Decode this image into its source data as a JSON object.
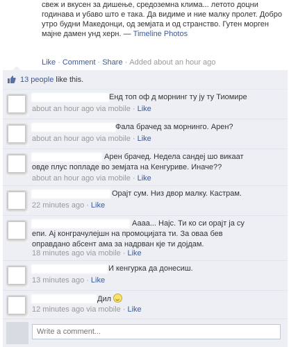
{
  "post": {
    "text": "свеж и вкусен за дишење, средоземна клима... летото доцни годинава и убаво што е така. Да видиме и ние малку пролет. Добро утро будни Македонци, од земјата и од странство. Гутен морген мајне дамен унд херн. —",
    "link": "Timeline Photos",
    "actions": [
      "Like",
      "Comment",
      "Share"
    ],
    "timestamp": "Added about an hour ago"
  },
  "likes": {
    "link": "13 people",
    "suffix": " like this."
  },
  "comments": [
    {
      "text": "Енд топ оф д морнинг ту ју ту Тиомире",
      "time": "about an hour ago",
      "via": "via mobile",
      "like": "Like"
    },
    {
      "text": "Фала брачед за морнинго. Арен?",
      "time": "about an hour ago",
      "via": "via mobile",
      "like": "Like"
    },
    {
      "text": "Арен брачед. Недела сандеј шо викаат овде плус попладе во земјата на Кенгуриве. Иначе??",
      "time": "about an hour ago",
      "via": "via mobile",
      "like": "Like"
    },
    {
      "text": "Орајт сум. Низ двор малку. Кастрам.",
      "time": "22 minutes ago",
      "via": "",
      "like": "Like"
    },
    {
      "text": "Аааа... Најс. Ти ко си орајт ја су епи. Ај конграчулејшн на промоцијата ти. За оваа бев оправдано абсент ама за надрван кје ти дојдам.",
      "time": "18 minutes ago",
      "via": "via mobile",
      "like": "Like"
    },
    {
      "text": "И кенгурка да донесиш.",
      "time": "13 minutes ago",
      "via": "",
      "like": "Like"
    },
    {
      "text": "Дил",
      "time": "12 minutes ago",
      "via": "via mobile",
      "like": "Like"
    }
  ],
  "composer": {
    "placeholder": "Write a comment..."
  },
  "icons": {
    "like": "thumbs-up-icon",
    "mobile": "mobile-phone-icon",
    "smiley": "smiley-emoticon-icon"
  },
  "colors": {
    "link": "#3b5998",
    "panel": "#edeff4",
    "meta": "#999999"
  }
}
